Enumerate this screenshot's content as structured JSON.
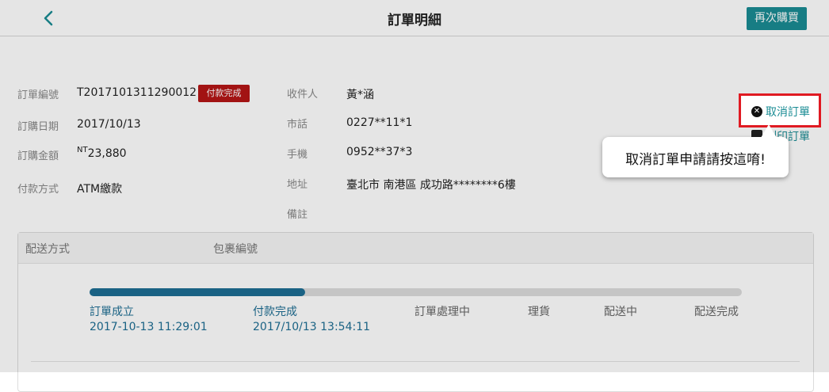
{
  "header": {
    "title": "訂單明細",
    "rebuy_label": "再次購買"
  },
  "order": {
    "number_label": "訂單編號",
    "number": "T2017101311290012",
    "status_badge": "付款完成",
    "date_label": "訂購日期",
    "date": "2017/10/13",
    "amount_label": "訂購金額",
    "currency": "NT",
    "amount": "23,880",
    "payment_label": "付款方式",
    "payment": "ATM繳款"
  },
  "recipient": {
    "name_label": "收件人",
    "name": "黃*涵",
    "phone_label": "市話",
    "phone": "0227**11*1",
    "mobile_label": "手機",
    "mobile": "0952**37*3",
    "address_label": "地址",
    "address": "臺北市 南港區 成功路********6樓",
    "note_label": "備註",
    "note": ""
  },
  "actions": {
    "cancel_label": "取消訂單",
    "print_label": "列印訂單"
  },
  "tooltip": {
    "text": "取消訂單申請請按這唷!"
  },
  "shipping": {
    "method_label": "配送方式",
    "package_label": "包裹編號",
    "progress": 0.33,
    "steps": [
      {
        "label": "訂單成立",
        "date": "2017-10-13 11:29:01"
      },
      {
        "label": "付款完成",
        "date": "2017/10/13 13:54:11"
      },
      {
        "label": "訂單處理中",
        "date": ""
      },
      {
        "label": "理貨",
        "date": ""
      },
      {
        "label": "配送中",
        "date": ""
      },
      {
        "label": "配送完成",
        "date": ""
      }
    ]
  },
  "colors": {
    "accent": "#1a8c94",
    "progress": "#1d6e93",
    "badge": "#b51616",
    "highlight": "#e01a22"
  }
}
